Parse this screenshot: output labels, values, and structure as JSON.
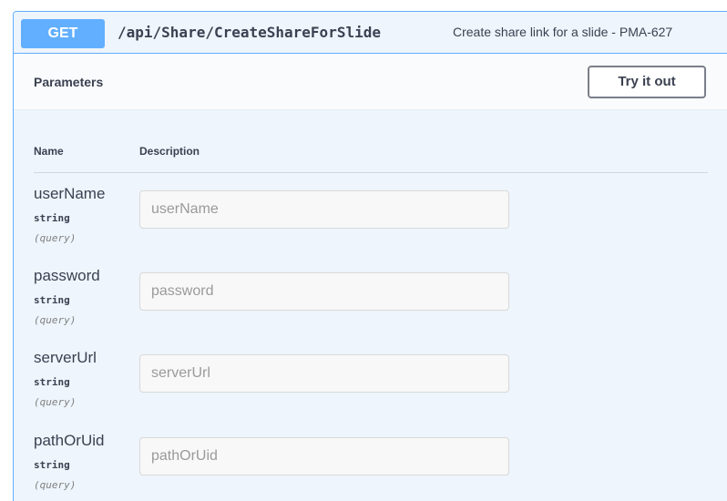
{
  "operation": {
    "method": "GET",
    "path": "/api/Share/CreateShareForSlide",
    "summary": "Create share link for a slide - PMA-627"
  },
  "parameters_section": {
    "title": "Parameters",
    "try_button_label": "Try it out",
    "column_name": "Name",
    "column_description": "Description"
  },
  "params": [
    {
      "name": "userName",
      "type": "string",
      "in": "(query)",
      "placeholder": "userName"
    },
    {
      "name": "password",
      "type": "string",
      "in": "(query)",
      "placeholder": "password"
    },
    {
      "name": "serverUrl",
      "type": "string",
      "in": "(query)",
      "placeholder": "serverUrl"
    },
    {
      "name": "pathOrUid",
      "type": "string",
      "in": "(query)",
      "placeholder": "pathOrUid"
    }
  ],
  "colors": {
    "get_method": "#61affe",
    "block_background": "#eef5fc",
    "text": "#3b4151"
  }
}
